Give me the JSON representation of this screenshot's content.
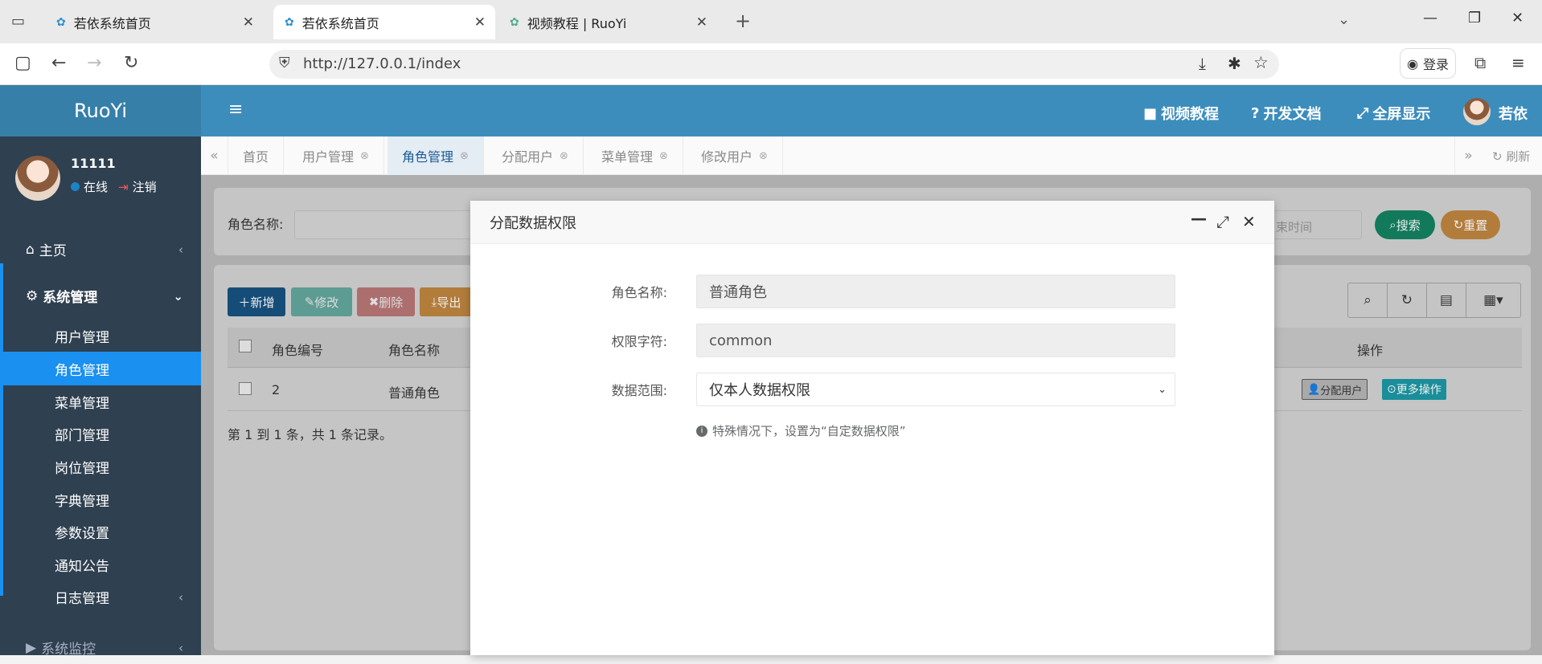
{
  "browser": {
    "tabs": [
      {
        "title": "若依系统首页"
      },
      {
        "title": "若依系统首页"
      },
      {
        "title": "视频教程 | RuoYi"
      }
    ],
    "url": "http://127.0.0.1/index",
    "login_label": "登录"
  },
  "app": {
    "brand": "RuoYi",
    "user": {
      "name": "11111",
      "status": "在线",
      "logout": "注销"
    },
    "menu": [
      {
        "label": "主页"
      },
      {
        "label": "系统管理"
      },
      {
        "label": "用户管理"
      },
      {
        "label": "角色管理"
      },
      {
        "label": "菜单管理"
      },
      {
        "label": "部门管理"
      },
      {
        "label": "岗位管理"
      },
      {
        "label": "字典管理"
      },
      {
        "label": "参数设置"
      },
      {
        "label": "通知公告"
      },
      {
        "label": "日志管理"
      },
      {
        "label": "系统监控"
      }
    ],
    "topnav": {
      "video": "视频教程",
      "docs": "开发文档",
      "fullscreen": "全屏显示",
      "username": "若依"
    },
    "page_tabs": [
      "首页",
      "用户管理",
      "角色管理",
      "分配用户",
      "菜单管理",
      "修改用户"
    ],
    "refresh": "刷新"
  },
  "search": {
    "role_name_label": "角色名称:",
    "end_time_placeholder": "束时间",
    "search_btn": "搜索",
    "reset_btn": "重置"
  },
  "toolbar": {
    "add": "新增",
    "edit": "修改",
    "delete": "删除",
    "export": "导出"
  },
  "table": {
    "headers": {
      "role_id": "角色编号",
      "role_name": "角色名称",
      "ops": "操作"
    },
    "rows": [
      {
        "role_id": "2",
        "role_name": "普通角色",
        "assign_user": "分配用户",
        "more": "更多操作"
      }
    ],
    "pagination": "第 1 到 1 条，共 1 条记录。"
  },
  "modal": {
    "title": "分配数据权限",
    "role_name_label": "角色名称:",
    "role_name_value": "普通角色",
    "perm_label": "权限字符:",
    "perm_value": "common",
    "scope_label": "数据范围:",
    "scope_value": "仅本人数据权限",
    "hint": "特殊情况下，设置为“自定数据权限”"
  },
  "colors": {
    "brand_blue": "#3c8dbc",
    "sidebar": "#2f4050",
    "active_menu": "#1a90f0"
  }
}
